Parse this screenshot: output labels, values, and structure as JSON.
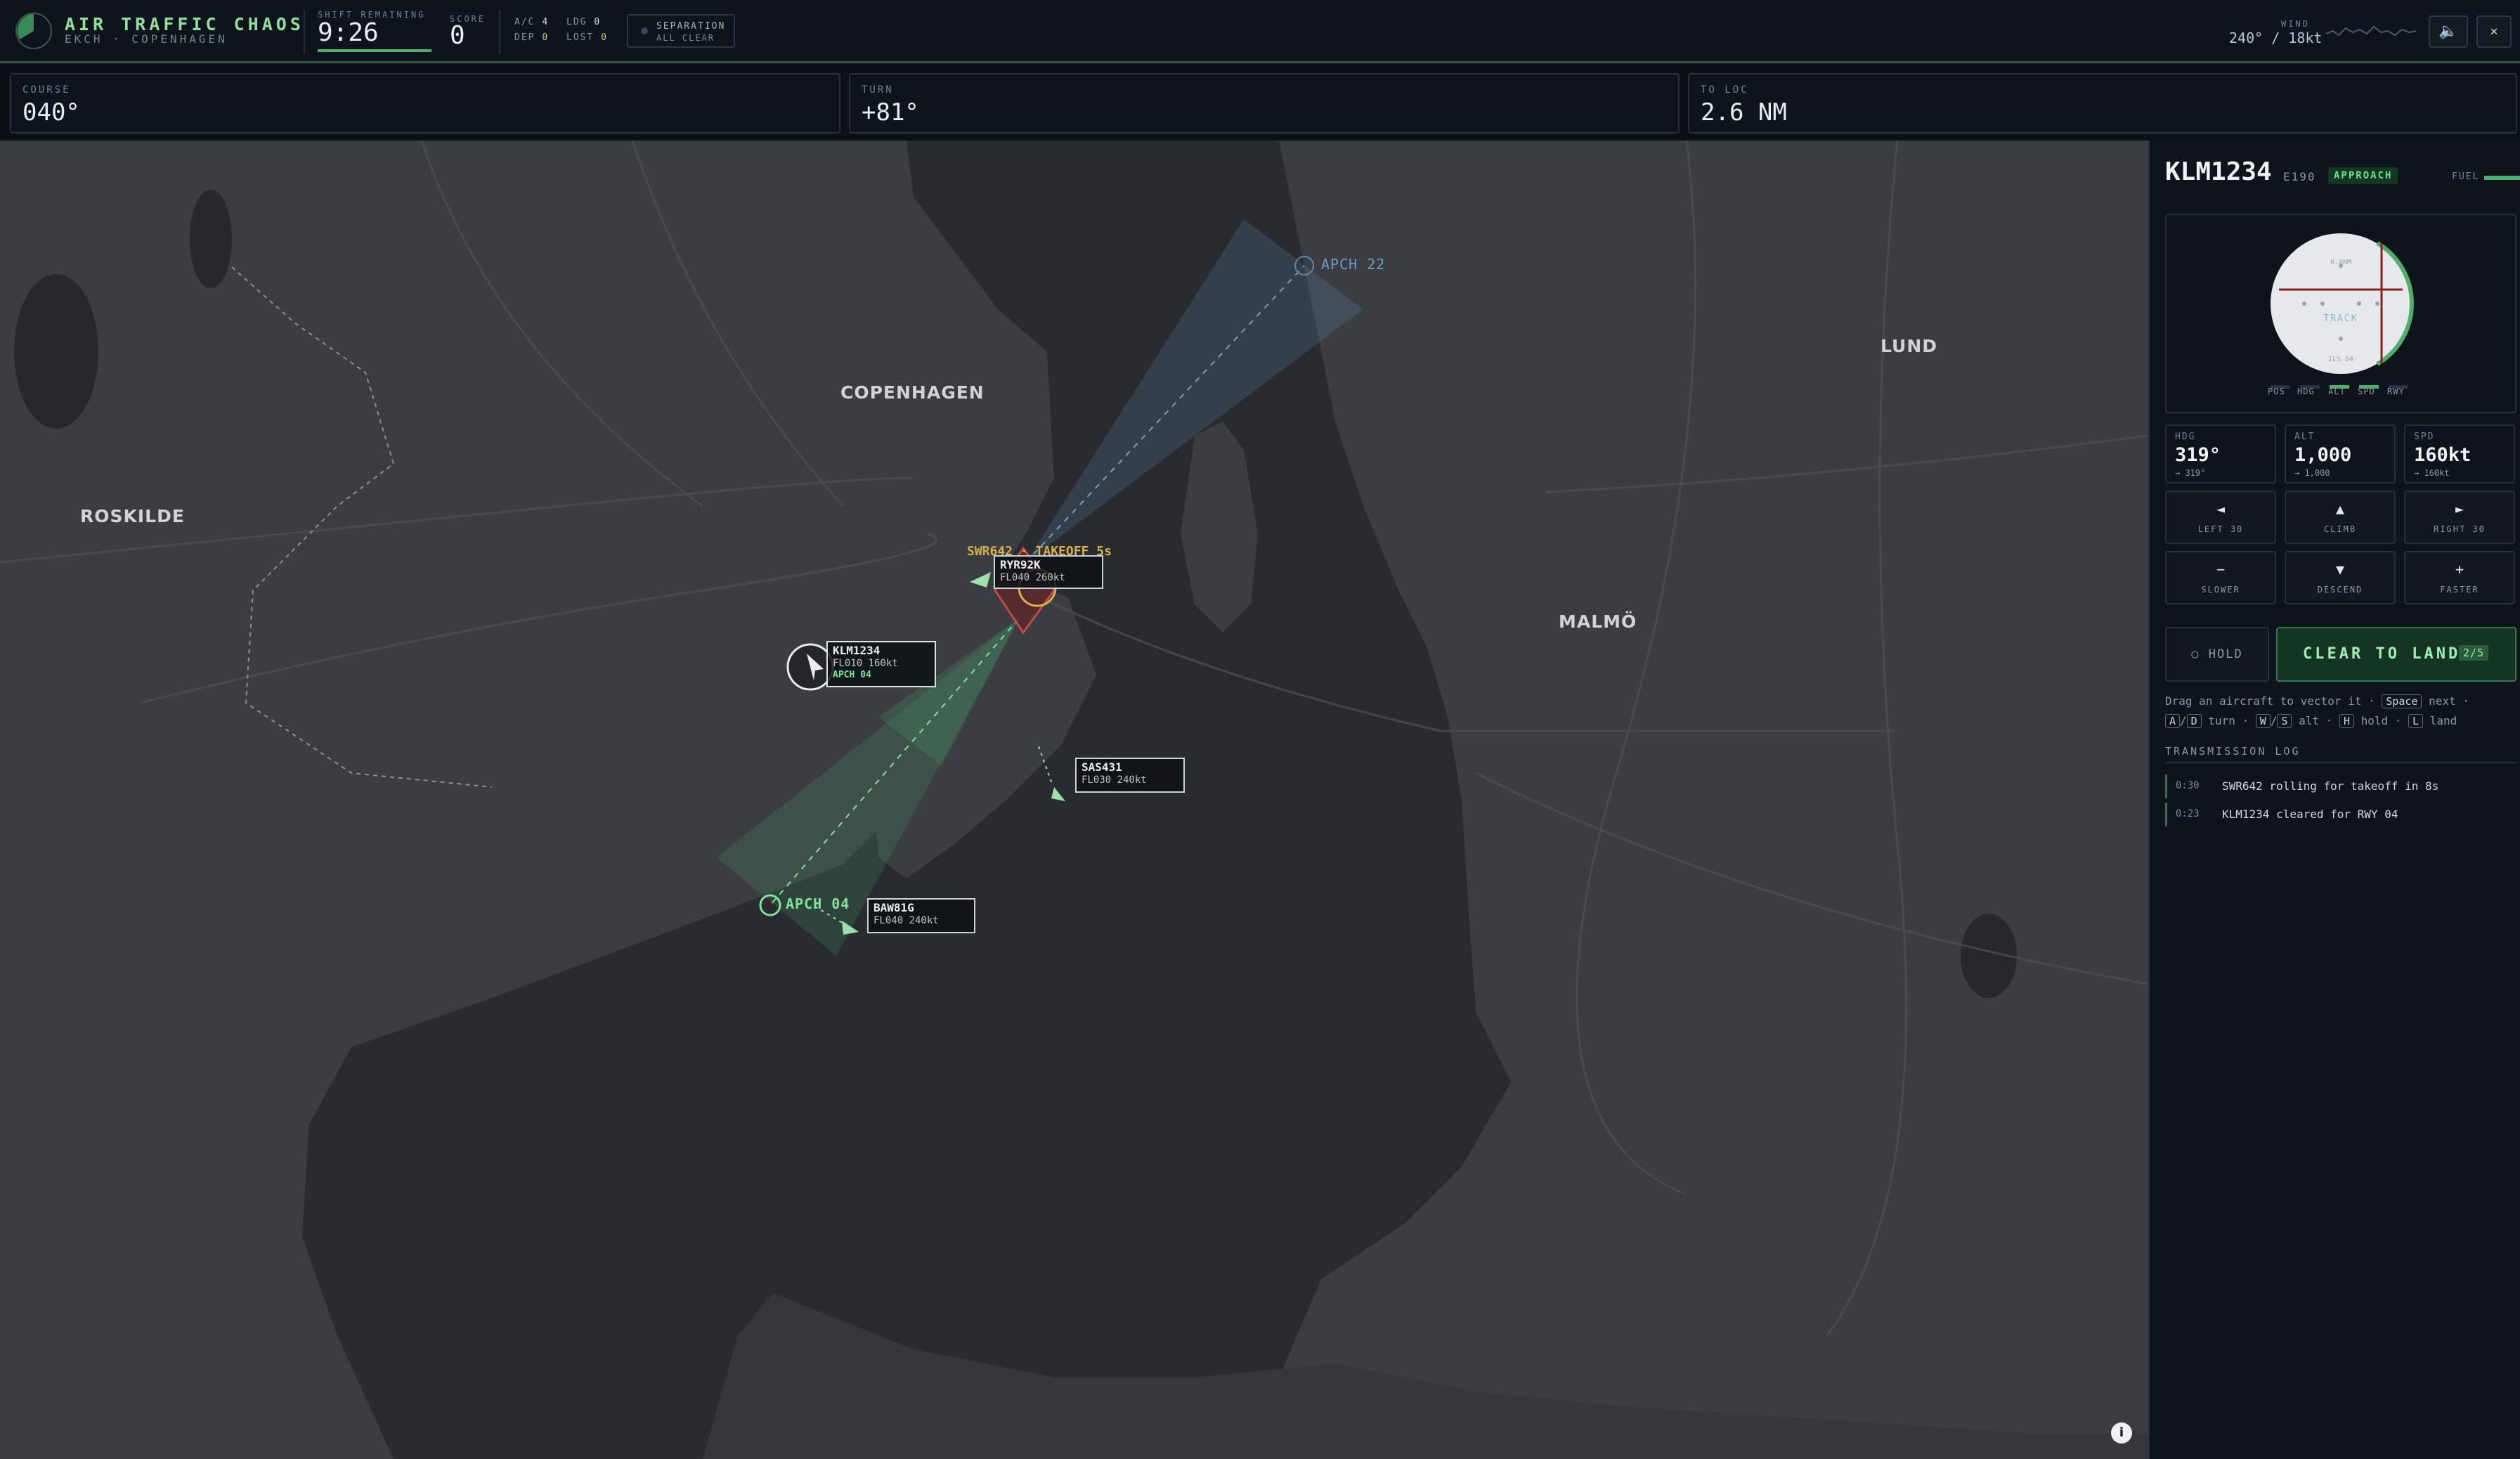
{
  "header": {
    "title": "AIR TRAFFIC CHAOS",
    "subtitle": "EKCH · COPENHAGEN",
    "shift_label": "SHIFT REMAINING",
    "shift_value": "9:26",
    "score_label": "SCORE",
    "score_value": "0",
    "ac_label": "A/C",
    "ac_value": "4",
    "ldg_label": "LDG",
    "ldg_value": "0",
    "dep_label": "DEP",
    "dep_value": "0",
    "lost_label": "LOST",
    "lost_value": "0",
    "separation_label": "SEPARATION",
    "separation_status": "ALL CLEAR",
    "wind_label": "WIND",
    "wind_value": "240° / 18kt",
    "sound_icon": "speaker-icon",
    "close_icon": "close-icon"
  },
  "info_bar": {
    "course_label": "COURSE",
    "course_value": "040°",
    "turn_label": "TURN",
    "turn_value": "+81°",
    "loc_label": "TO LOC",
    "loc_value": "2.6 NM"
  },
  "map": {
    "cities": {
      "copenhagen": "COPENHAGEN",
      "roskilde": "ROSKILDE",
      "malmo": "MALMÖ",
      "lund": "LUND"
    },
    "apch22": "APCH 22",
    "apch04": "APCH 04",
    "takeoff_msg": "SWR642 · TAKEOFF 5s",
    "aircraft": [
      {
        "callsign": "KLM1234",
        "data": "FL010 160kt",
        "status": "APCH 04"
      },
      {
        "callsign": "RYR92K",
        "data": "FL040 260kt"
      },
      {
        "callsign": "SAS431",
        "data": "FL030 240kt"
      },
      {
        "callsign": "BAW81G",
        "data": "FL040 240kt"
      }
    ]
  },
  "panel": {
    "callsign": "KLM1234",
    "type": "E190",
    "phase": "APPROACH",
    "fuel_label": "FUEL",
    "fuel_level": 0.9,
    "gauge_labels": [
      "POS",
      "HDG",
      "ALT",
      "SPD",
      "RWY"
    ],
    "gauge_text": {
      "top": "0.4NM",
      "mid": "TRACK",
      "bottom": "ILS 04"
    },
    "hdg": {
      "label": "HDG",
      "value": "319°",
      "target": "→ 319°"
    },
    "alt": {
      "label": "ALT",
      "value": "1,000",
      "target": "→ 1,000"
    },
    "spd": {
      "label": "SPD",
      "value": "160kt",
      "target": "→ 160kt"
    },
    "buttons": {
      "left": {
        "icon": "◄",
        "label": "LEFT 30"
      },
      "climb": {
        "icon": "▲",
        "label": "CLIMB"
      },
      "right": {
        "icon": "►",
        "label": "RIGHT 30"
      },
      "slower": {
        "icon": "−",
        "label": "SLOWER"
      },
      "descend": {
        "icon": "▼",
        "label": "DESCEND"
      },
      "faster": {
        "icon": "+",
        "label": "FASTER"
      }
    },
    "hold_label": "○ HOLD",
    "land_label": "CLEAR TO LAND",
    "land_count": "2/5",
    "help": {
      "line1": "Drag an aircraft to vector it ·",
      "space": "Space",
      "next": "next ·",
      "a": "A",
      "d": "D",
      "turn": "turn ·",
      "w": "W",
      "s": "S",
      "alt": "alt ·",
      "h": "H",
      "hold": "hold ·",
      "l": "L",
      "land": "land"
    },
    "log_title": "TRANSMISSION LOG",
    "log": [
      {
        "time": "0:30",
        "msg": "SWR642 rolling for takeoff in 8s"
      },
      {
        "time": "0:23",
        "msg": "KLM1234 cleared for RWY 04"
      }
    ]
  },
  "colors": {
    "accent": "#8fe0a0",
    "warning": "#e0c66a",
    "conflict": "#d24a4a",
    "approach22": "#6fa0c8"
  }
}
